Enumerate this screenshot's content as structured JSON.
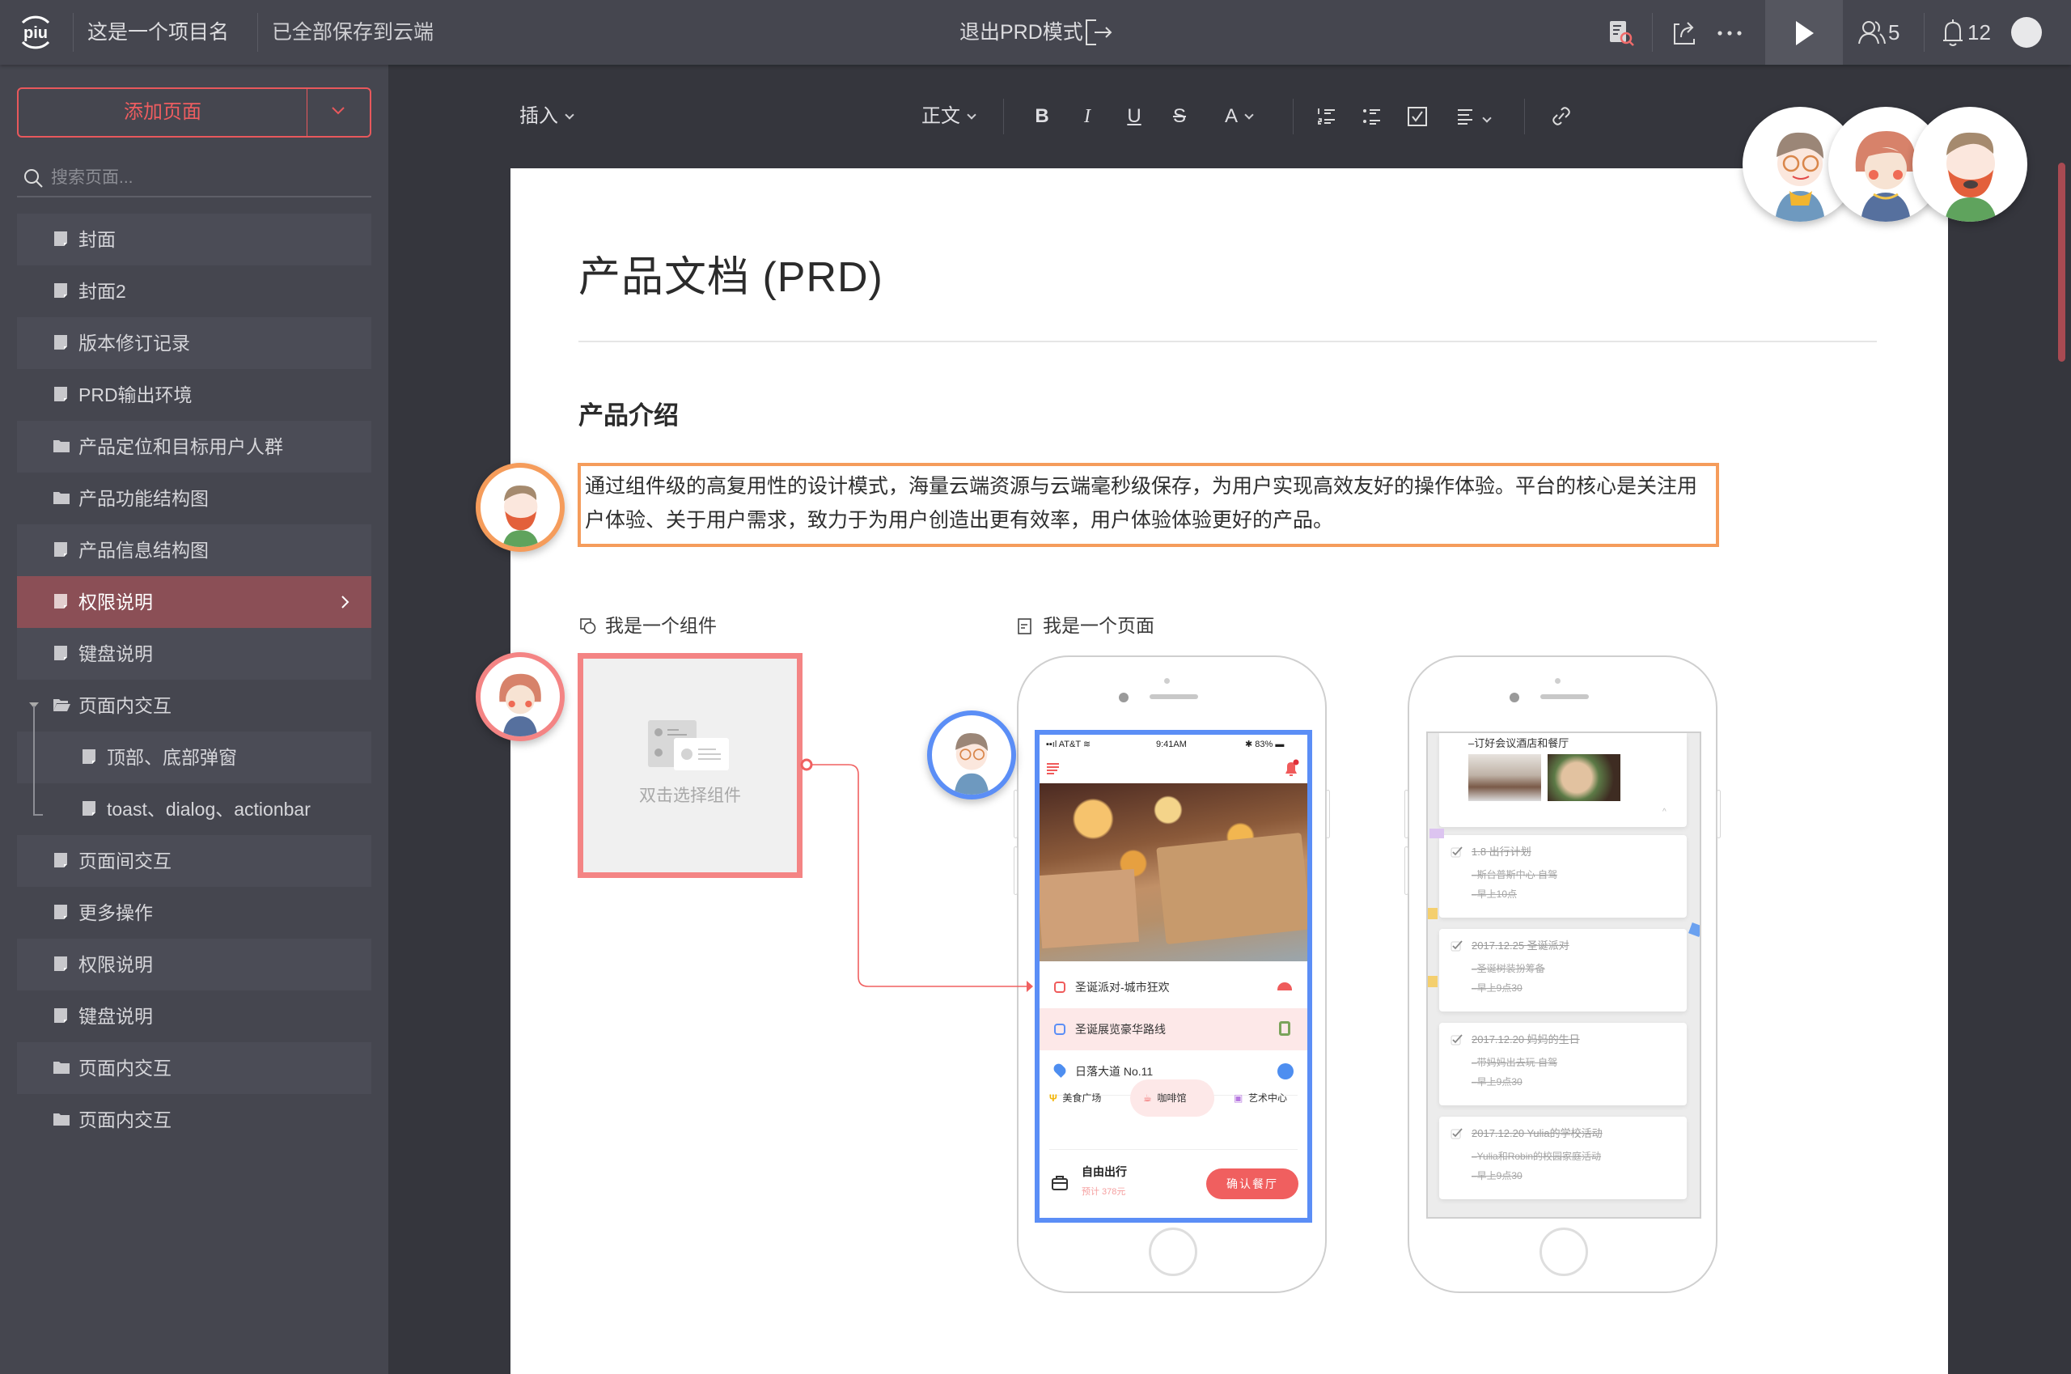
{
  "topbar": {
    "logo_text": "piu",
    "project_name": "这是一个项目名",
    "save_status": "已全部保存到云端",
    "exit_prd_label": "退出PRD模式",
    "collaborators_count": "5",
    "notifications_count": "12",
    "icons": [
      "doc-search-icon",
      "share-icon",
      "more-icon",
      "play-icon",
      "users-icon",
      "bell-icon",
      "user-avatar"
    ]
  },
  "sidebar": {
    "add_page_label": "添加页面",
    "search_placeholder": "搜索页面...",
    "items": [
      {
        "label": "封面",
        "type": "page",
        "level": 0
      },
      {
        "label": "封面2",
        "type": "page",
        "level": 0
      },
      {
        "label": "版本修订记录",
        "type": "page",
        "level": 0
      },
      {
        "label": "PRD输出环境",
        "type": "page",
        "level": 0
      },
      {
        "label": "产品定位和目标用户人群",
        "type": "folder",
        "level": 0
      },
      {
        "label": "产品功能结构图",
        "type": "folder",
        "level": 0
      },
      {
        "label": "产品信息结构图",
        "type": "page",
        "level": 0
      },
      {
        "label": "权限说明",
        "type": "page",
        "level": 0,
        "active": true
      },
      {
        "label": "键盘说明",
        "type": "page",
        "level": 0
      },
      {
        "label": "页面内交互",
        "type": "folder-open",
        "level": 0
      },
      {
        "label": "顶部、底部弹窗",
        "type": "page",
        "level": 1
      },
      {
        "label": "toast、dialog、actionbar",
        "type": "page",
        "level": 1
      },
      {
        "label": "页面间交互",
        "type": "page",
        "level": 0
      },
      {
        "label": "更多操作",
        "type": "page",
        "level": 0
      },
      {
        "label": "权限说明",
        "type": "page",
        "level": 0
      },
      {
        "label": "键盘说明",
        "type": "page",
        "level": 0
      },
      {
        "label": "页面内交互",
        "type": "folder",
        "level": 0
      },
      {
        "label": "页面内交互",
        "type": "folder",
        "level": 0
      }
    ]
  },
  "toolbar": {
    "insert_label": "插入",
    "style_label": "正文",
    "bold": "B",
    "italic": "I",
    "underline": "U",
    "strike": "S",
    "font_color": "A"
  },
  "document": {
    "title": "产品文档 (PRD)",
    "section_heading": "产品介绍",
    "paragraph": "通过组件级的高复用性的设计模式，海量云端资源与云端毫秒级保存，为用户实现高效友好的操作体验。平台的核心是关注用户体验、关于用户需求，致力于为用户创造出更有效率，用户体验体验更好的产品。",
    "component_label": "我是一个组件",
    "component_hint": "双击选择组件",
    "page_label": "我是一个页面"
  },
  "phone1": {
    "carrier": "AT&T",
    "time": "9:41AM",
    "battery": "83%",
    "rows": [
      {
        "label": "圣诞派对-城市狂欢"
      },
      {
        "label": "圣诞展览豪华路线"
      },
      {
        "label": "日落大道 No.11"
      }
    ],
    "categories": [
      "美食广场",
      "咖啡馆",
      "艺术中心"
    ],
    "footer_title": "自由出行",
    "footer_price": "预计 378元",
    "confirm_button": "确认餐厅"
  },
  "phone2": {
    "top_card_text": "–订好会议酒店和餐厅",
    "cards": [
      {
        "title": "1.8 出行计划",
        "lines": [
          "–斯台普斯中心 自驾",
          "–早上10点"
        ]
      },
      {
        "title": "2017.12.25 圣诞派对",
        "lines": [
          "–圣诞树装扮筹备",
          "–早上9点30"
        ]
      },
      {
        "title": "2017.12.20 妈妈的生日",
        "lines": [
          "–带妈妈出去玩 自驾",
          "–早上9点30"
        ]
      },
      {
        "title": "2017.12.20 Yulia的学校活动",
        "lines": [
          "–Yulia和Robin的校园家庭活动",
          "–早上9点30"
        ]
      }
    ]
  },
  "colors": {
    "accent": "#e8585c",
    "active_item": "#8b4f56",
    "highlight_orange": "#f59c5b",
    "component_border": "#f48484",
    "page_border": "#5b8ef6",
    "scrollbar": "#a94a52"
  }
}
